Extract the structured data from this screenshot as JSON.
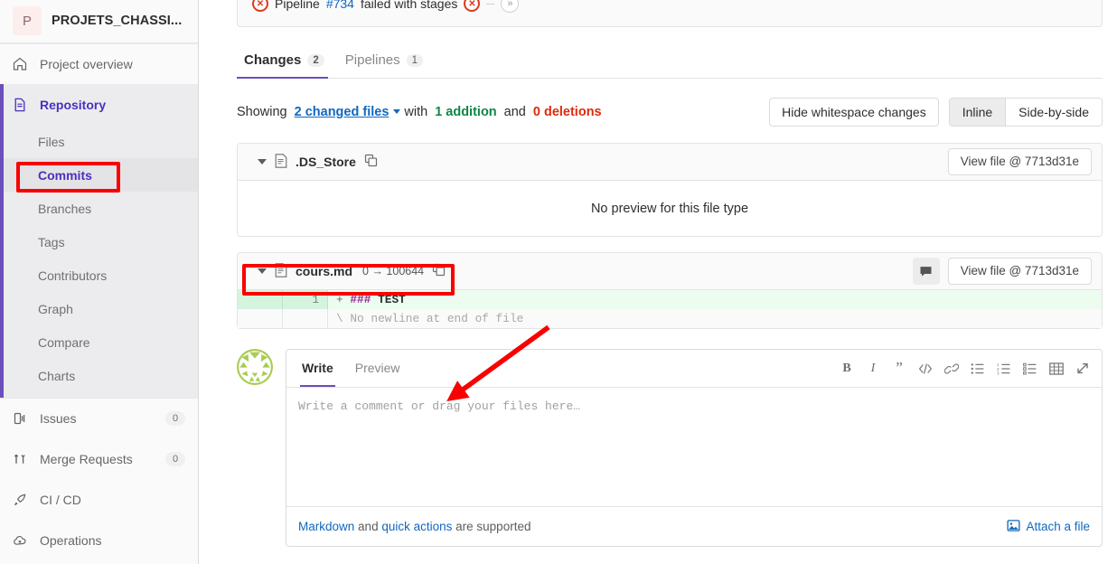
{
  "sidebar": {
    "project": {
      "initial": "P",
      "name": "PROJETS_CHASSI..."
    },
    "overview": {
      "label": "Project overview",
      "icon": "home-icon"
    },
    "repository": {
      "label": "Repository",
      "icon": "document-icon"
    },
    "repo_items": [
      {
        "label": "Files"
      },
      {
        "label": "Commits"
      },
      {
        "label": "Branches"
      },
      {
        "label": "Tags"
      },
      {
        "label": "Contributors"
      },
      {
        "label": "Graph"
      },
      {
        "label": "Compare"
      },
      {
        "label": "Charts"
      }
    ],
    "items": [
      {
        "label": "Issues",
        "icon": "issues-icon",
        "badge": "0"
      },
      {
        "label": "Merge Requests",
        "icon": "merge-request-icon",
        "badge": "0"
      },
      {
        "label": "CI / CD",
        "icon": "rocket-icon",
        "badge": ""
      },
      {
        "label": "Operations",
        "icon": "cloud-icon",
        "badge": ""
      }
    ]
  },
  "pipeline": {
    "prefix": "Pipeline",
    "id": "#734",
    "suffix": "failed with stages",
    "status_glyph": "✕",
    "expand_glyph": "»"
  },
  "tabs": [
    {
      "label": "Changes",
      "count": "2",
      "active": true
    },
    {
      "label": "Pipelines",
      "count": "1",
      "active": false
    }
  ],
  "showing": {
    "prefix": "Showing",
    "changed_files": "2 changed files",
    "with": "with",
    "additions": "1 addition",
    "and": "and",
    "deletions": "0 deletions"
  },
  "controls": {
    "hide_whitespace": "Hide whitespace changes",
    "inline": "Inline",
    "side_by_side": "Side-by-side",
    "selected_view": "Inline"
  },
  "files": [
    {
      "name": ".DS_Store",
      "mode": "",
      "view_file": "View file @ 7713d31e",
      "body_text": "No preview for this file type",
      "has_comment_button": false
    },
    {
      "name": "cours.md",
      "mode": "0 → 100644",
      "view_file": "View file @ 7713d31e",
      "has_comment_button": true,
      "diff": {
        "line_number": "1",
        "marker": "+",
        "heading_marks": "###",
        "heading_text": "TEST",
        "no_newline": "\\ No newline at end of file"
      }
    }
  ],
  "comment": {
    "tabs": [
      {
        "label": "Write",
        "active": true
      },
      {
        "label": "Preview",
        "active": false
      }
    ],
    "placeholder": "Write a comment or drag your files here…",
    "toolbar": [
      {
        "name": "bold-icon",
        "glyph": "B"
      },
      {
        "name": "italic-icon",
        "glyph": "I"
      },
      {
        "name": "quote-icon",
        "glyph": "”"
      },
      {
        "name": "code-icon",
        "glyph": "</>"
      },
      {
        "name": "link-icon",
        "glyph": "🔗"
      },
      {
        "name": "bullet-list-icon",
        "glyph": "≡"
      },
      {
        "name": "numbered-list-icon",
        "glyph": "≡"
      },
      {
        "name": "task-list-icon",
        "glyph": "≡"
      },
      {
        "name": "table-icon",
        "glyph": "▦"
      },
      {
        "name": "fullscreen-icon",
        "glyph": "⤡"
      }
    ],
    "footer": {
      "markdown": "Markdown",
      "and": "and",
      "quick_actions": "quick actions",
      "supported": "are supported",
      "attach": "Attach a file"
    }
  },
  "colors": {
    "accent_purple": "#6b4fbb",
    "link_blue": "#1068bf",
    "addition_green": "#108548",
    "deletion_red": "#dd2b0e",
    "annotation_red": "#fa0000",
    "diff_add_bg": "#ecfdf0"
  }
}
